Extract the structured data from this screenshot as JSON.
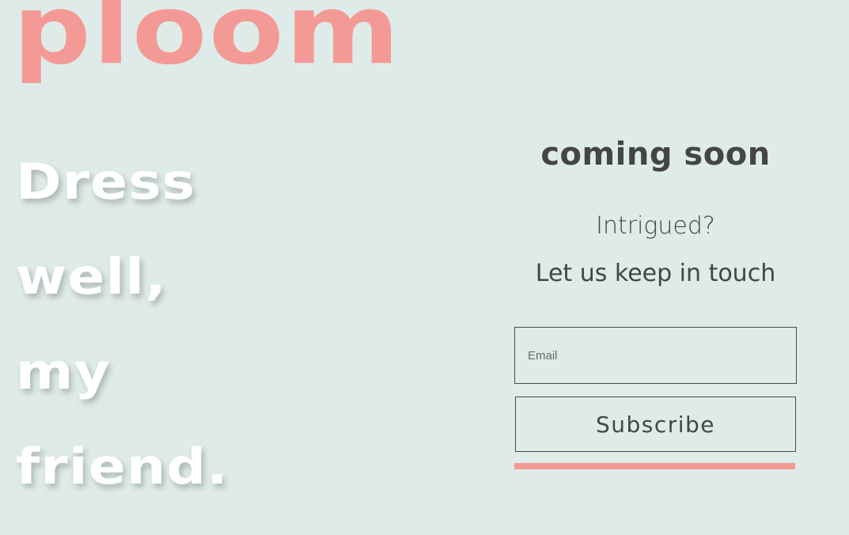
{
  "brand": {
    "logo_text": "ploom"
  },
  "tagline": {
    "lines": [
      "Dress",
      "well,",
      "my",
      "friend."
    ]
  },
  "signup": {
    "heading": "coming soon",
    "intro": "Intrigued?",
    "subheading": "Let us keep in touch",
    "email_placeholder": "Email",
    "email_value": "",
    "subscribe_label": "Subscribe"
  },
  "colors": {
    "background": "#deebe8",
    "accent": "#f49a96",
    "text": "#444546",
    "tagline": "#ffffff"
  }
}
